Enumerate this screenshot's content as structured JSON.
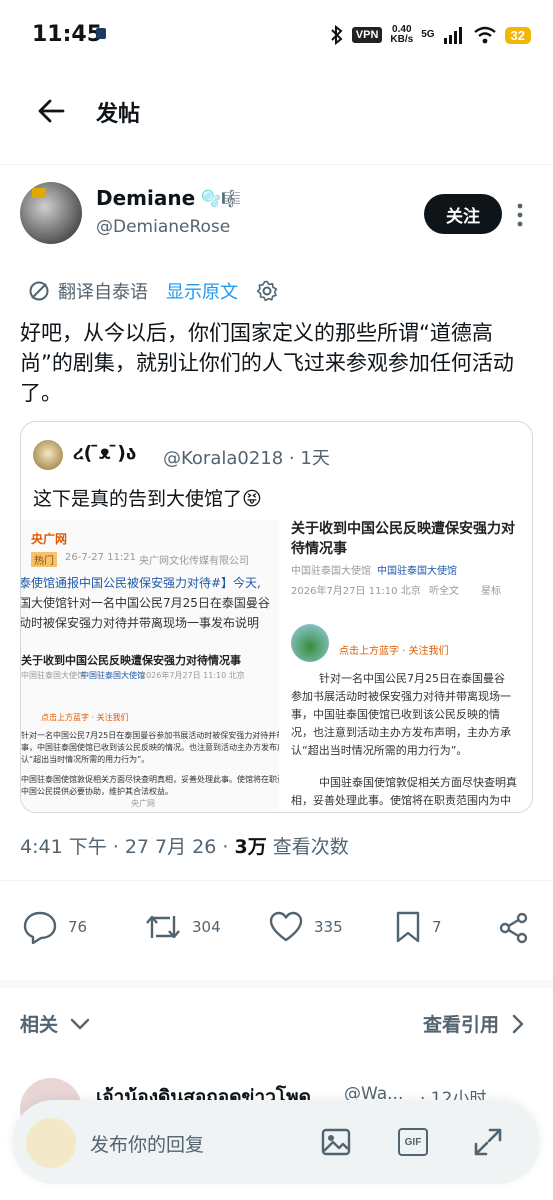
{
  "status_bar": {
    "time": "11:45",
    "vpn": "VPN",
    "speed_value": "0.40",
    "speed_unit": "KB/s",
    "network": "5G",
    "battery": "32"
  },
  "header": {
    "title": "发帖"
  },
  "post": {
    "author_name": "Demiane",
    "author_emoji": "🫧🎼",
    "author_handle": "@DemianeRose",
    "follow_label": "关注",
    "translate_label": "翻译自泰语",
    "show_original_label": "显示原文",
    "text": "好吧，从今以后，你们国家定义的那些所谓“道德高尚”的剧集，就别让你们的人飞过来参观参加任何活动了。",
    "quote": {
      "name": "ረ( ̄ᴥ ̄)ა",
      "handle": "@Korala0218",
      "time": "1天",
      "text": "这下是真的告到大使馆了😝",
      "img1": {
        "source": "央广网",
        "hot": "热门",
        "date": "26-7-27 11:21",
        "org": "央广网文化传媒有限公司",
        "l1": "泰使馆通报中国公民被保安强力对待#】今天,",
        "l2": "国大使馆针对一名中国公民7月25日在泰国曼谷",
        "l3": "动时被保安强力对待并带离现场一事发布说明",
        "h2": "关于收到中国公民反映遭保安强力对待情况事",
        "s1": "中国驻泰国大使馆",
        "s2": "中国驻泰国大使馆",
        "s3": "2026年7月27日 11:10 北京",
        "follow": "点击上方蓝字 · 关注我们",
        "p1": "针对一名中国公民7月25日在泰国曼谷参加书展活动时被保安强力对待并带离",
        "p2": "事，中国驻泰国使馆已收到该公民反映的情况。也注意到活动主办方发布声明",
        "p3": "认“超出当时情况所需的用力行为”。",
        "p4": "中国驻泰国使馆敦促相关方面尽快查明真相，妥善处理此事。使馆将在职责范",
        "p5": "中国公民提供必要协助，维护其合法权益。",
        "watermark": "央广网"
      },
      "img2": {
        "h1": "关于收到中国公民反映遭保安强力对",
        "h2": "待情况事",
        "s1": "中国驻泰国大使馆",
        "s2": "中国驻泰国大使馆",
        "date": "2026年7月27日 11:10 北京",
        "listen": "听全文",
        "star": "星标",
        "follow": "点击上方蓝字 · 关注我们",
        "p1": "针对一名中国公民7月25日在泰国曼谷",
        "p2": "参加书展活动时被保安强力对待并带离现场一",
        "p3": "事，中国驻泰国使馆已收到该公民反映的情",
        "p4": "况，也注意到活动主办方发布声明，主办方承",
        "p5": "认“超出当时情况所需的用力行为”。",
        "p6": "中国驻泰国使馆敦促相关方面尽快查明真",
        "p7": "相，妥善处理此事。使馆将在职责范围内为中"
      }
    },
    "meta_time": "4:41 下午 · 27 7月 26 · ",
    "views_count": "3万",
    "views_label": " 查看次数",
    "actions": {
      "replies": "76",
      "reposts": "304",
      "likes": "335",
      "bookmarks": "7"
    }
  },
  "related_label": "相关",
  "view_quotes_label": "查看引用",
  "next_post": {
    "name": "เจ้าน้องดินสอถอดข่าวโพด",
    "handle": "@Wa...",
    "time": "· 12小时"
  },
  "reply_bar": {
    "placeholder": "发布你的回复",
    "gif": "GIF"
  }
}
